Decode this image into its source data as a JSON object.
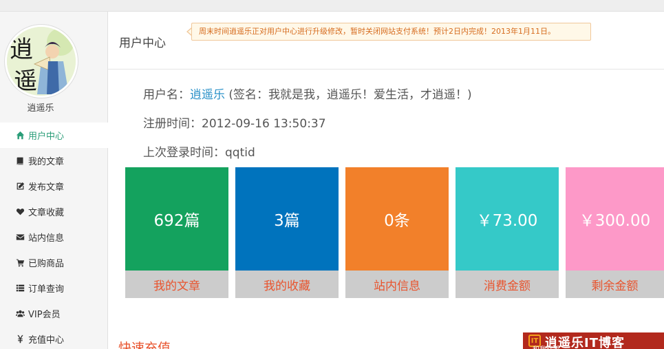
{
  "sidebar": {
    "username": "逍遥乐",
    "menu": [
      {
        "label": "用户中心",
        "icon": "home-icon"
      },
      {
        "label": "我的文章",
        "icon": "book-icon"
      },
      {
        "label": "发布文章",
        "icon": "edit-icon"
      },
      {
        "label": "文章收藏",
        "icon": "heart-icon"
      },
      {
        "label": "站内信息",
        "icon": "envelope-icon"
      },
      {
        "label": "已购商品",
        "icon": "cart-icon"
      },
      {
        "label": "订单查询",
        "icon": "list-icon"
      },
      {
        "label": "VIP会员",
        "icon": "users-icon"
      },
      {
        "label": "充值中心",
        "icon": "yen-icon"
      }
    ]
  },
  "header": {
    "title": "用户中心",
    "notice": "周末时间逍遥乐正对用户中心进行升级修改，暂时关闭网站支付系统！预计2日内完成！2013年1月11日。"
  },
  "profile": {
    "username_label": "用户名：",
    "username": "逍遥乐",
    "signature": " (签名：我就是我，逍遥乐！爱生活，才逍遥！)",
    "register_label": "注册时间：",
    "register_time": "2012-09-16 13:50:37",
    "last_login_label": "上次登录时间：",
    "last_login": "qqtid"
  },
  "stats": [
    {
      "value": "692篇",
      "label": "我的文章",
      "color": "#14a25e"
    },
    {
      "value": "3篇",
      "label": "我的收藏",
      "color": "#0073bd"
    },
    {
      "value": "0条",
      "label": "站内信息",
      "color": "#f2802a"
    },
    {
      "value": "￥73.00",
      "label": "消费金额",
      "color": "#35c9c8"
    },
    {
      "value": "￥300.00",
      "label": "剩余金额",
      "color": "#fd99c8"
    }
  ],
  "section_title": "快速充值",
  "brand": {
    "logo": "IT",
    "name": "逍遥乐IT博客",
    "sub": "和我联系"
  },
  "colors": {
    "accent": "#2a9d78",
    "link": "#2a91c8",
    "label_red": "#e8542e"
  }
}
